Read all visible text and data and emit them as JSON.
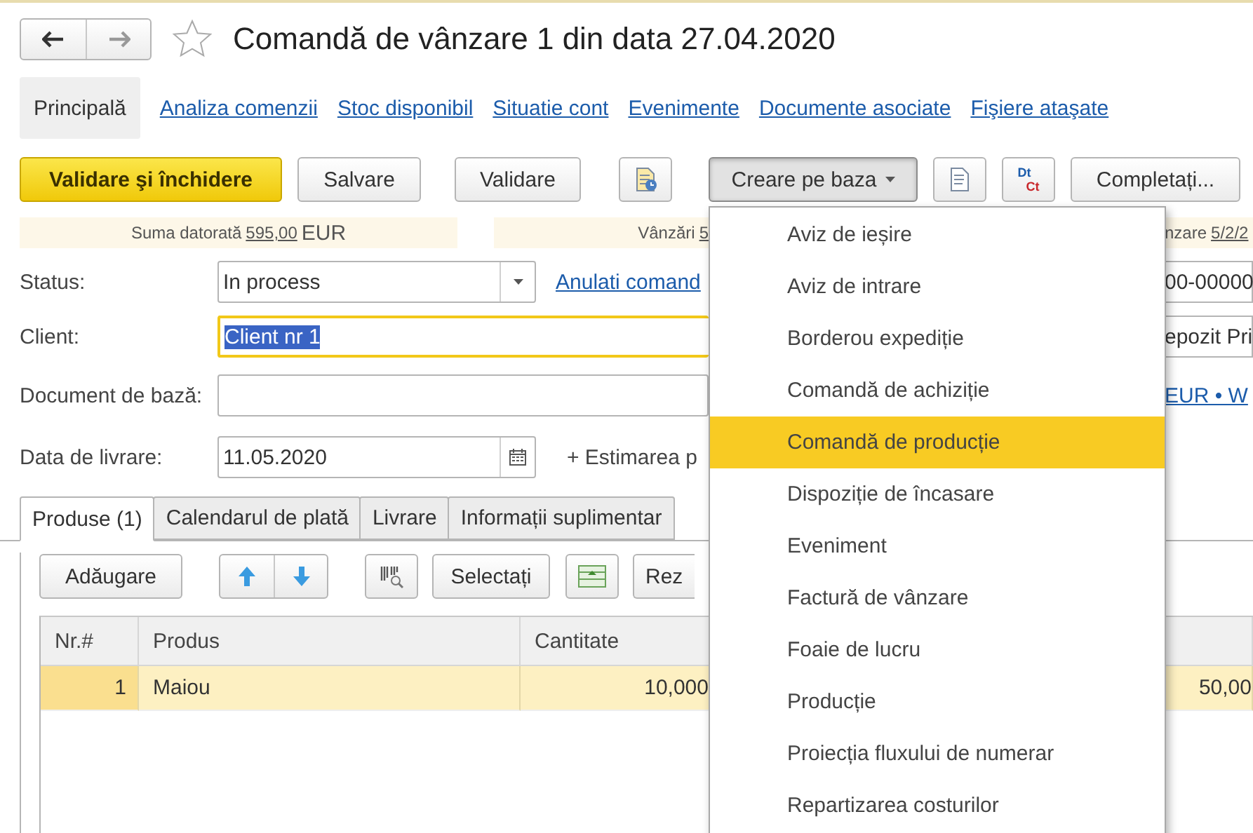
{
  "header": {
    "title": "Comandă de vânzare 1 din data 27.04.2020",
    "favorite": false
  },
  "nav_tabs": [
    {
      "label": "Principală",
      "selected": true
    },
    {
      "label": "Analiza comenzii",
      "selected": false
    },
    {
      "label": "Stoc disponibil",
      "selected": false
    },
    {
      "label": "Situatie cont",
      "selected": false
    },
    {
      "label": "Evenimente",
      "selected": false
    },
    {
      "label": "Documente asociate",
      "selected": false
    },
    {
      "label": "Fişiere ataşate",
      "selected": false
    }
  ],
  "toolbar": {
    "primary": "Validare şi închidere",
    "save": "Salvare",
    "post": "Validare",
    "create_based": {
      "label": "Creare pe baza",
      "expanded": true
    },
    "debit": "Dt",
    "credit": "Ct",
    "fill": "Completați..."
  },
  "summary": [
    {
      "label": "Suma datorată",
      "value": "595,00",
      "currency": "EUR"
    },
    {
      "label": "Vânzări",
      "value": "5"
    },
    {
      "label": "nzare",
      "value": "5/2/2"
    }
  ],
  "form": {
    "status": {
      "label": "Status:",
      "value": "In process",
      "link": "Anulati comand"
    },
    "client": {
      "label": "Client:",
      "value": "Client nr 1",
      "focused": true
    },
    "base_document": {
      "label": "Document de bază:"
    },
    "delivery_date": {
      "label": "Data de livrare:",
      "value": "11.05.2020",
      "extra": "+ Estimarea p"
    },
    "right_fields": [
      "00-00000",
      "epozit Pri"
    ],
    "right_link": "EUR • W"
  },
  "inner_tabs": [
    {
      "label": "Produse (1)",
      "selected": true
    },
    {
      "label": "Calendarul de plată",
      "selected": false
    },
    {
      "label": "Livrare",
      "selected": false
    },
    {
      "label": "Informații suplimentar",
      "selected": false
    }
  ],
  "table_toolbar": {
    "add": "Adăugare",
    "select": "Selectați",
    "column_6": "Rez"
  },
  "table": {
    "columns": [
      "Nr.#",
      "Produs",
      "Cantitate"
    ],
    "rows": [
      {
        "cells": [
          "1",
          "Maiou",
          "10,000"
        ],
        "column_4": "50,00",
        "selected": true
      }
    ]
  },
  "menu": {
    "items": [
      {
        "label": "Aviz de ieșire",
        "selected": false
      },
      {
        "label": "Aviz de intrare",
        "selected": false
      },
      {
        "label": "Borderou expediție",
        "selected": false
      },
      {
        "label": "Comandă de achiziție",
        "selected": false
      },
      {
        "label": "Comandă de producție",
        "selected": true
      },
      {
        "label": "Dispoziție de încasare",
        "selected": false
      },
      {
        "label": "Eveniment",
        "selected": false
      },
      {
        "label": "Factură de vânzare",
        "selected": false
      },
      {
        "label": "Foaie de lucru",
        "selected": false
      },
      {
        "label": "Producție",
        "selected": false
      },
      {
        "label": "Proiecția fluxului de numerar",
        "selected": false
      },
      {
        "label": "Repartizarea costurilor",
        "selected": false
      }
    ]
  }
}
